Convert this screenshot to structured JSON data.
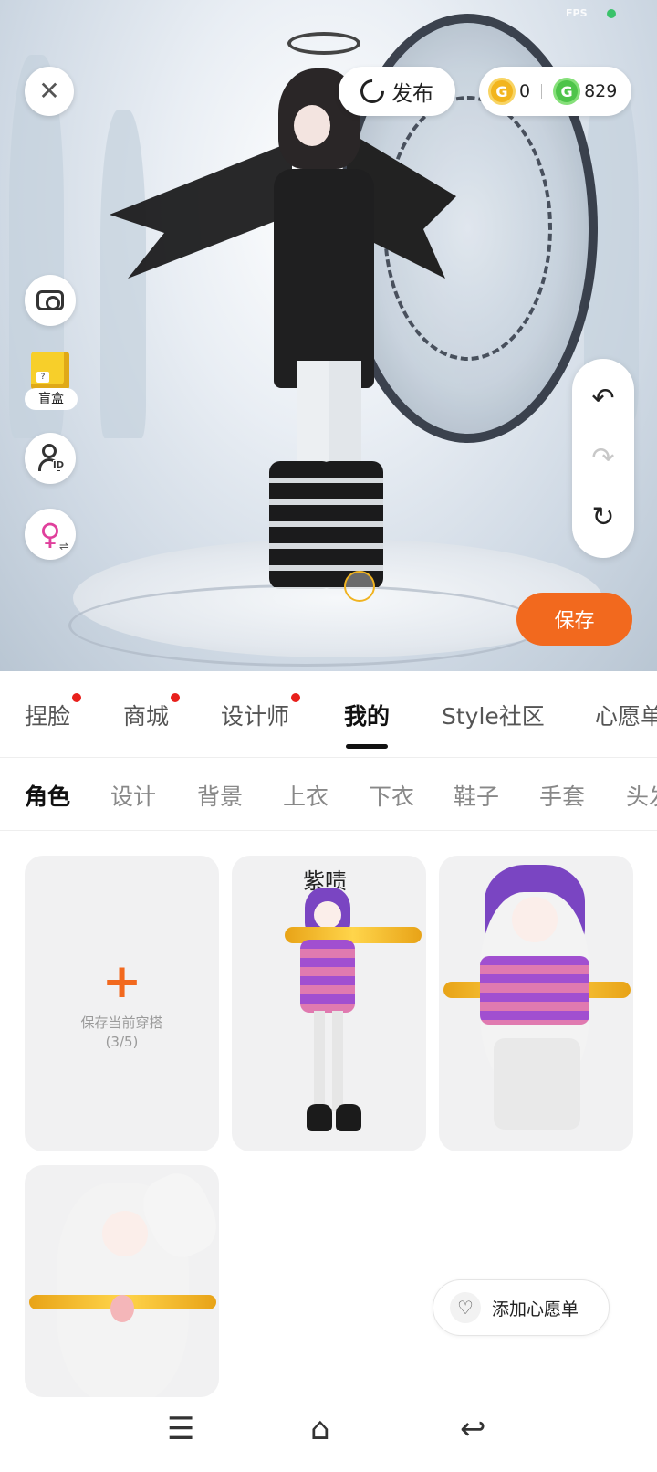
{
  "status": {
    "fps_label": "FPS"
  },
  "topbar": {
    "publish_label": "发布",
    "gold_coins": "0",
    "green_coins": "829"
  },
  "left_tools": {
    "blindbox_label": "盲盒",
    "blindbox_icon_glyph": "?"
  },
  "save_label": "保存",
  "main_tabs": [
    {
      "label": "捏脸",
      "has_dot": true
    },
    {
      "label": "商城",
      "has_dot": true
    },
    {
      "label": "设计师",
      "has_dot": true
    },
    {
      "label": "我的",
      "active": true
    },
    {
      "label": "Style社区"
    },
    {
      "label": "心愿单"
    }
  ],
  "sub_tabs": [
    {
      "label": "角色",
      "active": true
    },
    {
      "label": "设计"
    },
    {
      "label": "背景"
    },
    {
      "label": "上衣"
    },
    {
      "label": "下衣"
    },
    {
      "label": "鞋子"
    },
    {
      "label": "手套"
    },
    {
      "label": "头发"
    }
  ],
  "grid": {
    "add_card": {
      "plus": "+",
      "label": "保存当前穿搭",
      "count": "(3/5)"
    },
    "outfit_caption_1": "紫啧"
  },
  "wishlist_label": "添加心愿单",
  "colors": {
    "accent": "#f2691e",
    "badge": "#e8201c",
    "gold": "#f2b51e",
    "green": "#4ec44a"
  },
  "icons": [
    "close-icon",
    "publish-icon",
    "gold-coin-icon",
    "green-coin-icon",
    "camera-icon",
    "blindbox-icon",
    "avatar-id-icon",
    "gender-swap-icon",
    "undo-icon",
    "redo-icon",
    "reset-icon",
    "heart-icon",
    "menu-icon",
    "home-icon",
    "back-icon"
  ]
}
